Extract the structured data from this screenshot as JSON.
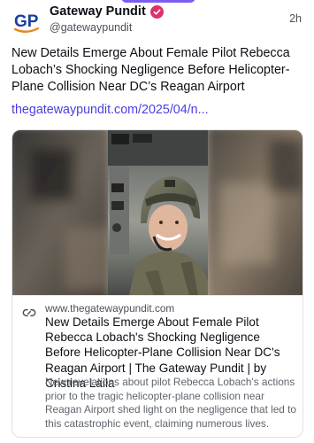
{
  "post": {
    "author": {
      "display_name": "Gateway Pundit",
      "handle": "@gatewaypundit",
      "avatar_text": "GP",
      "verified_icon": "verified-badge-icon"
    },
    "timestamp": "2h",
    "text": "New Details Emerge About Female Pilot Rebecca Lobach’s Shocking Negligence Before Helicopter-Plane Collision Near DC’s Reagan Airport",
    "link_text": "thegatewaypundit.com/2025/04/n..."
  },
  "link_card": {
    "link_icon": "link-icon",
    "domain": "www.thegatewaypundit.com",
    "title": "New Details Emerge About Female Pilot Rebecca Lobach's Shocking Negligence Before Helicopter-Plane Collision Near DC's Reagan Airport | The Gateway Pundit | by Cristina Laila",
    "description": "New revelations about pilot Rebecca Lobach's actions prior to the tragic helicopter-plane collision near Reagan Airport shed light on the negligence that led to this catastrophic event, claiming numerous lives."
  },
  "colors": {
    "link": "#4b3de0",
    "verified_badge": "#e0306a",
    "avatar_blue": "#1a3f9a",
    "avatar_orange": "#e8851c"
  }
}
